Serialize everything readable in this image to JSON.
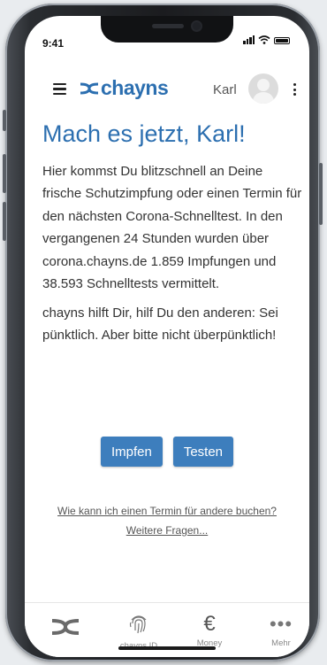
{
  "status_bar": {
    "time": "9:41"
  },
  "header": {
    "logo_text": "chayns",
    "user_name": "Karl"
  },
  "main": {
    "title": "Mach es jetzt, Karl!",
    "paragraph_1": "Hier kommst Du blitzschnell an Deine frische Schutzimpfung oder einen Termin für den nächsten Corona-Schnelltest. In den vergangenen 24 Stunden wurden über corona.chayns.de 1.859 Impfungen und 38.593 Schnelltests vermittelt.",
    "paragraph_2": "chayns hilft Dir, hilf Du den anderen: Sei pünktlich. Aber bitte nicht überpünktlich!",
    "buttons": {
      "vaccinate": "Impfen",
      "test": "Testen"
    },
    "links": {
      "book_for_others": "Wie kann ich einen Termin für andere buchen?",
      "more_questions": "Weitere Fragen..."
    }
  },
  "bottom_nav": {
    "items": [
      {
        "label": "",
        "icon": "chayns-logo-icon"
      },
      {
        "label": "chayns.ID",
        "icon": "fingerprint-icon"
      },
      {
        "label": "Money",
        "icon": "euro-icon",
        "glyph": "€"
      },
      {
        "label": "Mehr",
        "icon": "more-dots-icon",
        "glyph": "•••"
      }
    ]
  },
  "colors": {
    "accent": "#2c6fb0",
    "button": "#3d7ebd",
    "text": "#333333"
  }
}
